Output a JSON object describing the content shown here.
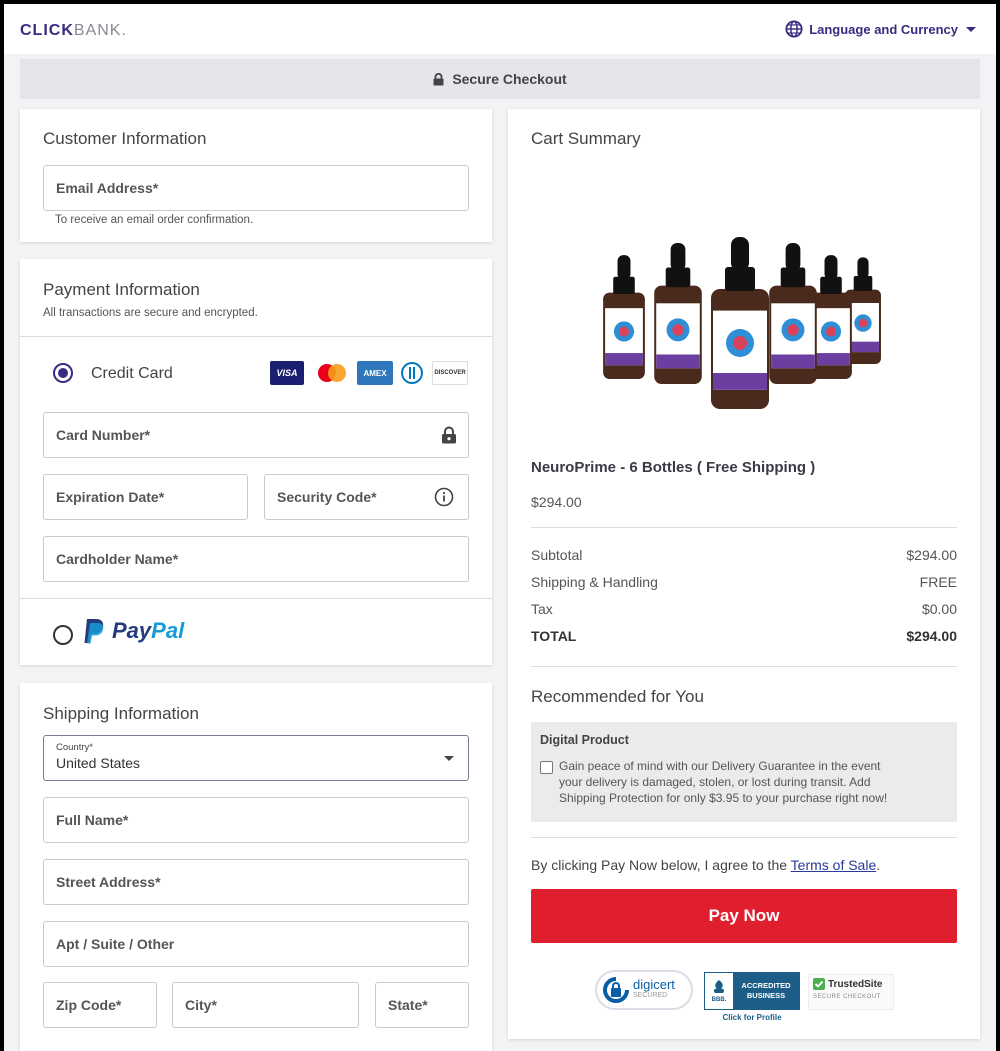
{
  "header": {
    "logo_bold": "CLICK",
    "logo_light": "BANK.",
    "language_label": "Language and Currency"
  },
  "secure_bar": {
    "label": "Secure Checkout"
  },
  "customer": {
    "title": "Customer Information",
    "email_label": "Email Address*",
    "email_hint": "To receive an email order confirmation."
  },
  "payment": {
    "title": "Payment Information",
    "subtitle": "All transactions are secure and encrypted.",
    "credit_card_label": "Credit Card",
    "card_logos": {
      "visa": "VISA",
      "amex": "AMEX",
      "discover": "DISCOVER"
    },
    "card_number_label": "Card Number*",
    "expiration_label": "Expiration Date*",
    "security_label": "Security Code*",
    "cardholder_label": "Cardholder Name*",
    "paypal_pay": "Pay",
    "paypal_pal": "Pal",
    "selected_method": "credit-card"
  },
  "shipping": {
    "title": "Shipping Information",
    "country_label": "Country*",
    "country_value": "United States",
    "full_name_label": "Full Name*",
    "street_label": "Street Address*",
    "apt_label": "Apt / Suite / Other",
    "zip_label": "Zip Code*",
    "city_label": "City*",
    "state_label": "State*"
  },
  "cart": {
    "title": "Cart Summary",
    "product_name": "NeuroPrime - 6 Bottles ( Free Shipping )",
    "product_price": "$294.00",
    "rows": [
      {
        "label": "Subtotal",
        "value": "$294.00"
      },
      {
        "label": "Shipping & Handling",
        "value": "FREE"
      },
      {
        "label": "Tax",
        "value": "$0.00"
      },
      {
        "label": "TOTAL",
        "value": "$294.00"
      }
    ],
    "recommended_title": "Recommended for You",
    "digital_title": "Digital Product",
    "digital_text_1": "Gain peace of mind with our Delivery Guarantee in the event",
    "digital_text_2": "your delivery is damaged, stolen, or lost during transit. Add",
    "digital_text_3": "Shipping Protection for only $3.95 to your purchase right now!",
    "terms_prefix": "By clicking Pay Now below, I agree to the ",
    "terms_link": "Terms of Sale",
    "terms_suffix": ".",
    "pay_button": "Pay Now",
    "badges": {
      "digicert": "digicert",
      "digicert_sub": "SECURED",
      "bbb_line1": "ACCREDITED",
      "bbb_line2": "BUSINESS",
      "bbb_logo": "BBB.",
      "bbb_profile": "Click for Profile",
      "trusted": "TrustedSite",
      "trusted_sub": "SECURE CHECKOUT"
    }
  },
  "colors": {
    "brand": "#3b2a80",
    "pay_button": "#e01f2e",
    "paypal_dark": "#253b80",
    "paypal_light": "#179bd7"
  }
}
